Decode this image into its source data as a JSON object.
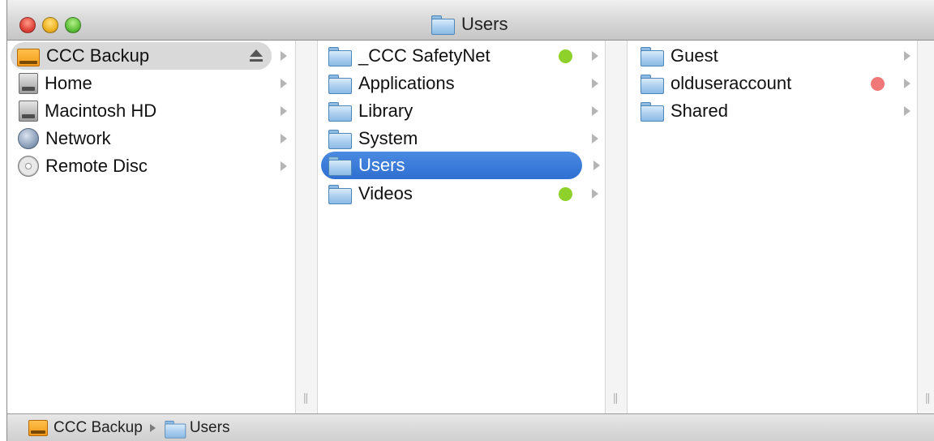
{
  "window": {
    "title": "Users"
  },
  "sidebar": {
    "items": [
      {
        "label": "CCC Backup",
        "icon": "external-drive-icon",
        "selected": true,
        "eject": true
      },
      {
        "label": "Home",
        "icon": "home-drive-icon"
      },
      {
        "label": "Macintosh HD",
        "icon": "hard-drive-icon"
      },
      {
        "label": "Network",
        "icon": "network-globe-icon"
      },
      {
        "label": "Remote Disc",
        "icon": "remote-disc-icon"
      }
    ]
  },
  "column2": {
    "items": [
      {
        "label": "_CCC SafetyNet",
        "label_color": "#8fd12b"
      },
      {
        "label": "Applications"
      },
      {
        "label": "Library"
      },
      {
        "label": "System"
      },
      {
        "label": "Users",
        "selected": true
      },
      {
        "label": "Videos",
        "label_color": "#8fd12b"
      }
    ]
  },
  "column3": {
    "items": [
      {
        "label": "Guest"
      },
      {
        "label": "olduseraccount",
        "label_color": "#f07878"
      },
      {
        "label": "Shared"
      }
    ]
  },
  "pathbar": {
    "segments": [
      {
        "label": "CCC Backup",
        "icon": "external-drive-icon"
      },
      {
        "label": "Users",
        "icon": "folder-icon"
      }
    ]
  },
  "colors": {
    "selection_blue": "#2e6fd1",
    "selection_gray": "#d9d9d9",
    "green_label": "#8fd12b",
    "red_label": "#f07878"
  }
}
